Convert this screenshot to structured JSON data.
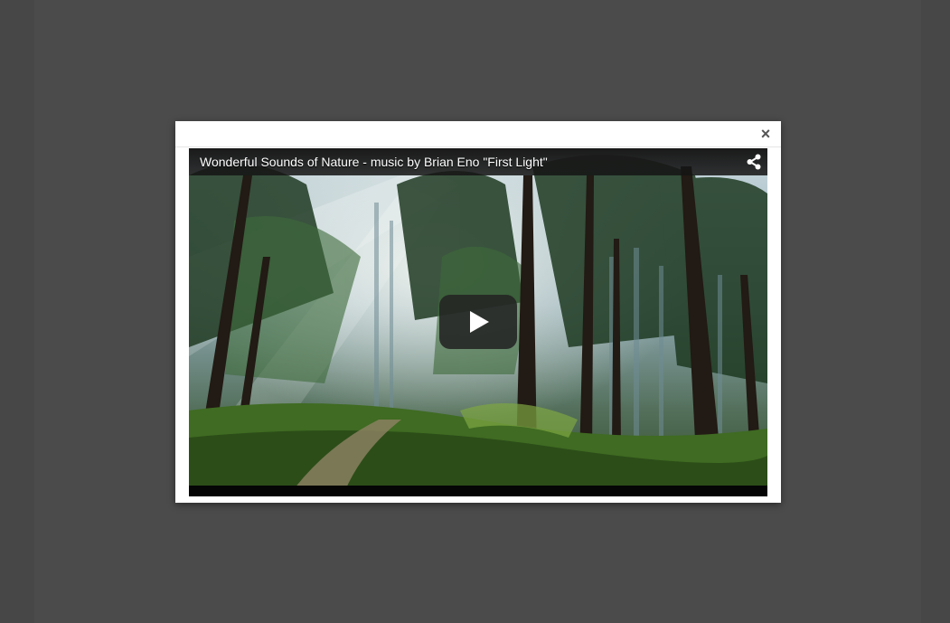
{
  "modal": {
    "close_label": "×"
  },
  "video": {
    "title": "Wonderful Sounds of Nature - music by Brian Eno \"First Light\""
  },
  "icons": {
    "close": "close-icon",
    "share": "share-icon",
    "play": "play-icon"
  },
  "colors": {
    "overlay": "#4b4b4b",
    "modal_bg": "#ffffff",
    "player_bg": "#000000"
  }
}
